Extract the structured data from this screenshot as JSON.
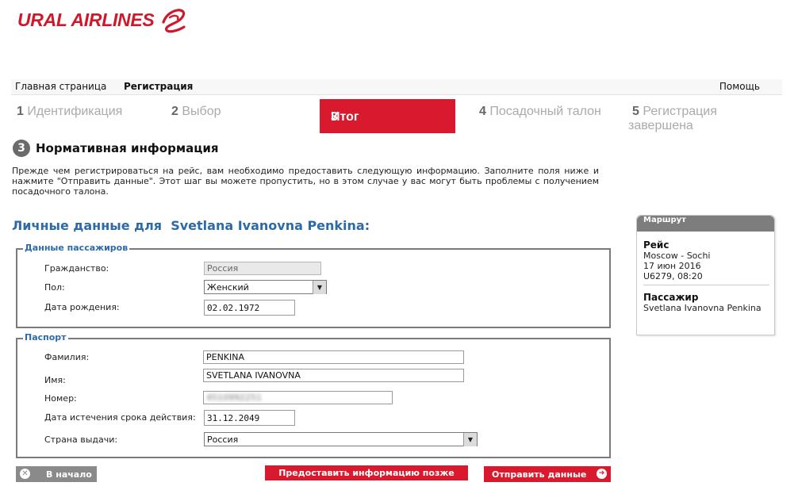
{
  "brand": {
    "name": "URAL AIRLINES",
    "color": "#d0182a"
  },
  "topnav": {
    "home": "Главная страница",
    "registration": "Регистрация",
    "help": "Помощь"
  },
  "steps": [
    {
      "num": "1",
      "label": "Идентификация"
    },
    {
      "num": "2",
      "label": "Выбор"
    },
    {
      "num": "3",
      "label": "Итог",
      "active": true
    },
    {
      "num": "4",
      "label": "Посадочный талон"
    },
    {
      "num": "5",
      "label": "Регистрация завершена"
    }
  ],
  "section": {
    "num": "3",
    "title": "Нормативная информация",
    "intro": "Прежде чем регистрироваться на рейс, вам необходимо предоставить следующую информацию. Заполните поля ниже и нажмите \"Отправить данные\". Этот шаг вы можете пропустить, но в этом случае у вас могут быть проблемы с получением посадочного талона."
  },
  "personal": {
    "title_prefix": "Личные данные для",
    "name": "Svetlana Ivanovna Penkina:"
  },
  "passenger": {
    "legend": "Данные пассажиров",
    "citizenship_label": "Гражданство:",
    "citizenship_value": "Россия",
    "gender_label": "Пол:",
    "gender_value": "Женский",
    "dob_label": "Дата рождения:",
    "dob_value": "02.02.1972"
  },
  "passport": {
    "legend": "Паспорт",
    "surname_label": "Фамилия:",
    "surname_value": "PENKINA",
    "name_label": "Имя:",
    "name_value": "SVETLANA IVANOVNA",
    "number_label": "Номер:",
    "number_value": "4510992251",
    "expiry_label": "Дата истечения срока действия:",
    "expiry_value": "31.12.2049",
    "country_label": "Страна выдачи:",
    "country_value": "Россия"
  },
  "buttons": {
    "back": "В начало",
    "later": "Предоставить информацию позже",
    "send": "Отправить данные"
  },
  "route": {
    "header": "Маршрут",
    "flight_title": "Рейс",
    "flight_route": "Moscow - Sochi",
    "flight_date": "17 июн 2016",
    "flight_code": "U6279, 08:20",
    "passenger_title": "Пассажир",
    "passenger_name": "Svetlana Ivanovna Penkina"
  },
  "icons": {
    "back": "close-circle-icon",
    "send": "arrow-right-circle-icon",
    "select": "chevron-down-icon"
  },
  "colors": {
    "accent": "#d9192d",
    "link_blue": "#2d6aa8"
  }
}
